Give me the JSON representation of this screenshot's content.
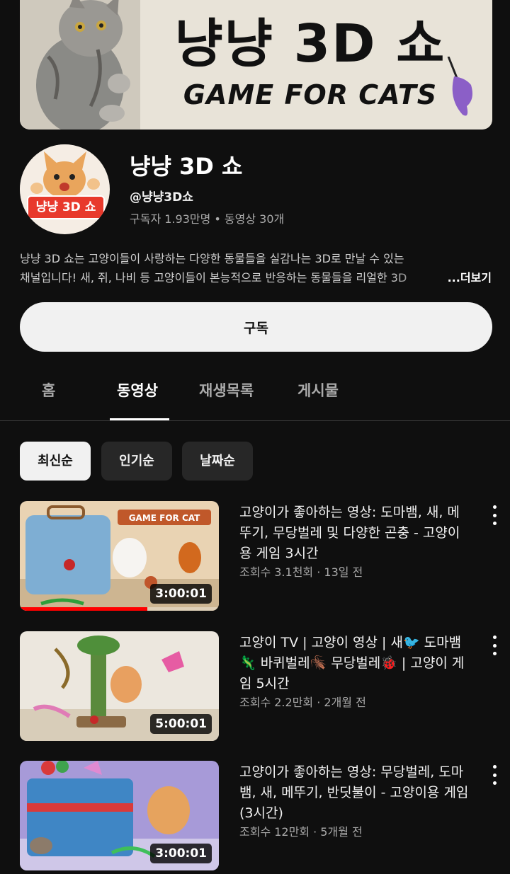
{
  "banner": {
    "title": "냥냥 3D 쇼",
    "subtitle": "GAME FOR CATS"
  },
  "channel": {
    "avatar_label": "냥냥 3D 쇼",
    "name": "냥냥 3D 쇼",
    "handle": "@냥냥3D쇼",
    "stats": "구독자 1.93만명 • 동영상 30개",
    "description_line1": "냥냥 3D 쇼는 고양이들이 사랑하는 다양한 동물들을 실감나는 3D로 만날 수 있는",
    "description_line2": "채널입니다! 새, 쥐, 나비 등 고양이들이 본능적으로 반응하는 동물들을 리얼한 3D",
    "more_label": "...더보기",
    "subscribe_label": "구독"
  },
  "tabs": [
    {
      "label": "홈"
    },
    {
      "label": "동영상"
    },
    {
      "label": "재생목록"
    },
    {
      "label": "게시물"
    }
  ],
  "chips": [
    {
      "label": "최신순"
    },
    {
      "label": "인기순"
    },
    {
      "label": "날짜순"
    }
  ],
  "videos": [
    {
      "thumb_text": "GAME FOR CAT",
      "duration": "3:00:01",
      "title": "고양이가 좋아하는 영상: 도마뱀, 새, 메뚜기, 무당벌레 및 다양한 곤충 - 고양이용 게임 3시간",
      "meta": "조회수 3.1천회 · 13일 전",
      "watched_fraction": 0.64
    },
    {
      "duration": "5:00:01",
      "title": "고양이 TV | 고양이 영상 | 새🐦 도마뱀 🦎 바퀴벌레🪳 무당벌레🐞 | 고양이 게임 5시간",
      "meta": "조회수 2.2만회 · 2개월 전"
    },
    {
      "duration": "3:00:01",
      "title": "고양이가 좋아하는 영상: 무당벌레, 도마뱀, 새, 메뚜기, 반딧불이 - 고양이용 게임 (3시간)",
      "meta": "조회수 12만회 · 5개월 전"
    }
  ],
  "colors": {
    "background": "#0f0f0f",
    "progress": "#ff0000",
    "avatar_label_bg": "#e8392c"
  }
}
